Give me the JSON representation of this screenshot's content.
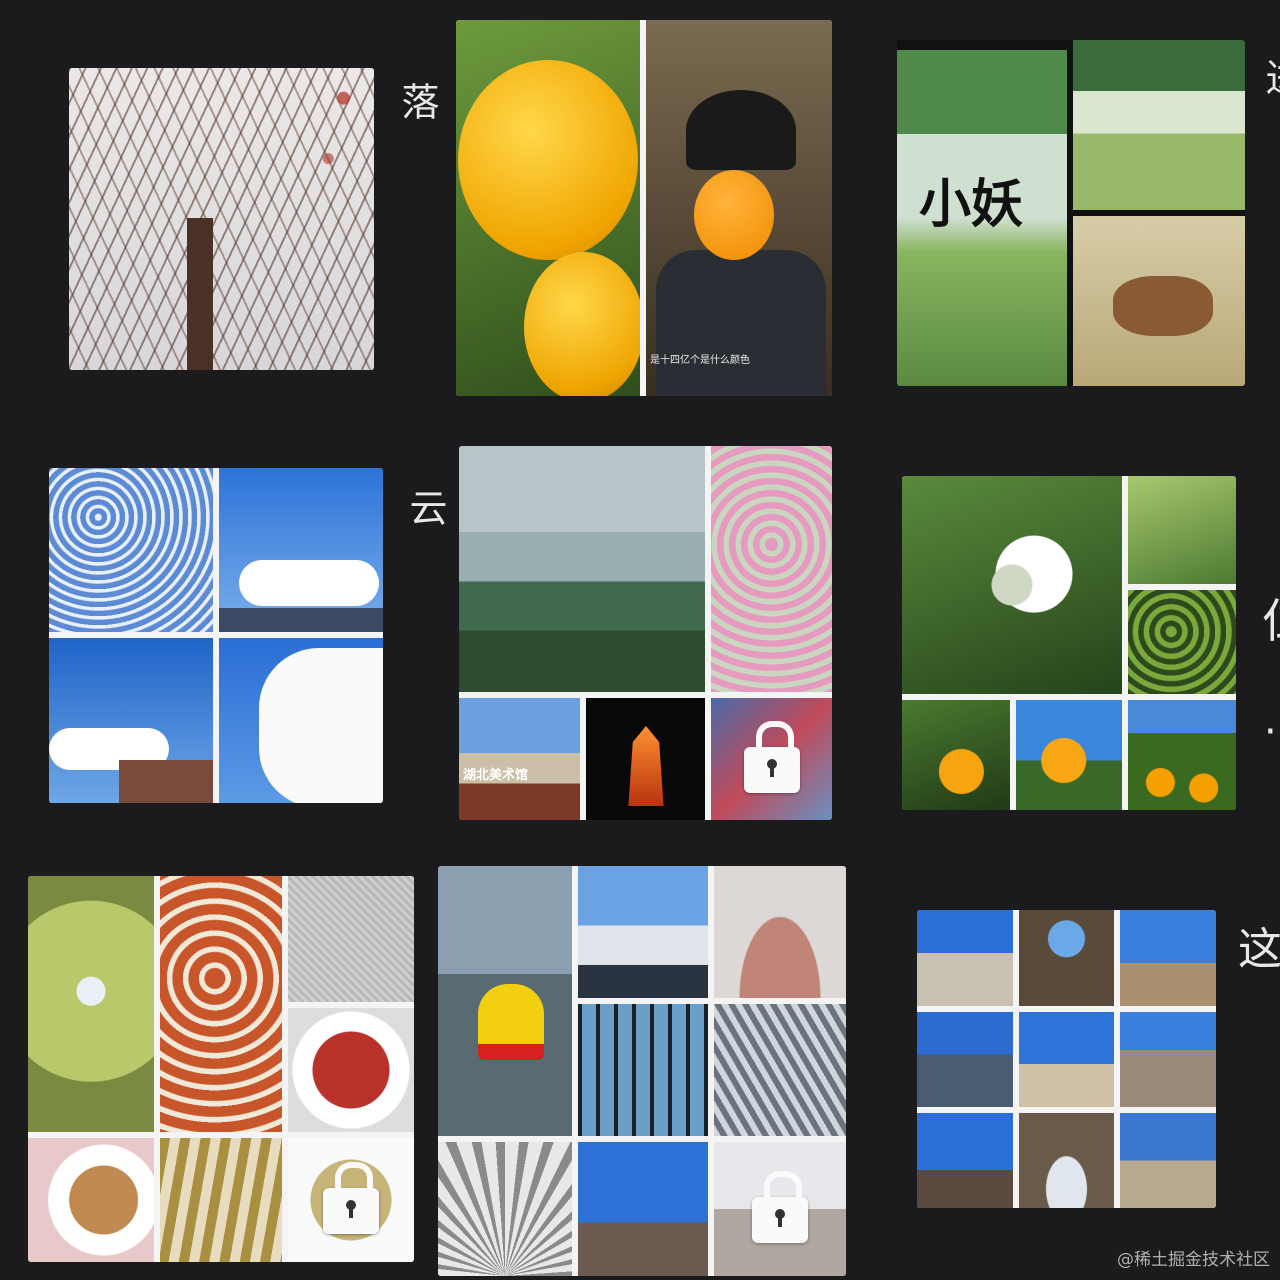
{
  "labels": {
    "a1": "落",
    "a2": "云",
    "a3": "这",
    "partial_top_right": "进",
    "partial_mid_right_1": "『",
    "partial_mid_right_2": "仁",
    "partial_mid_right_3": "·"
  },
  "cards": {
    "orange_caption": "是十四亿个是什么颜色",
    "cartoon_title": "小妖",
    "hubei_sign": "湖北美术馆"
  },
  "watermark": "@稀土掘金技术社区"
}
